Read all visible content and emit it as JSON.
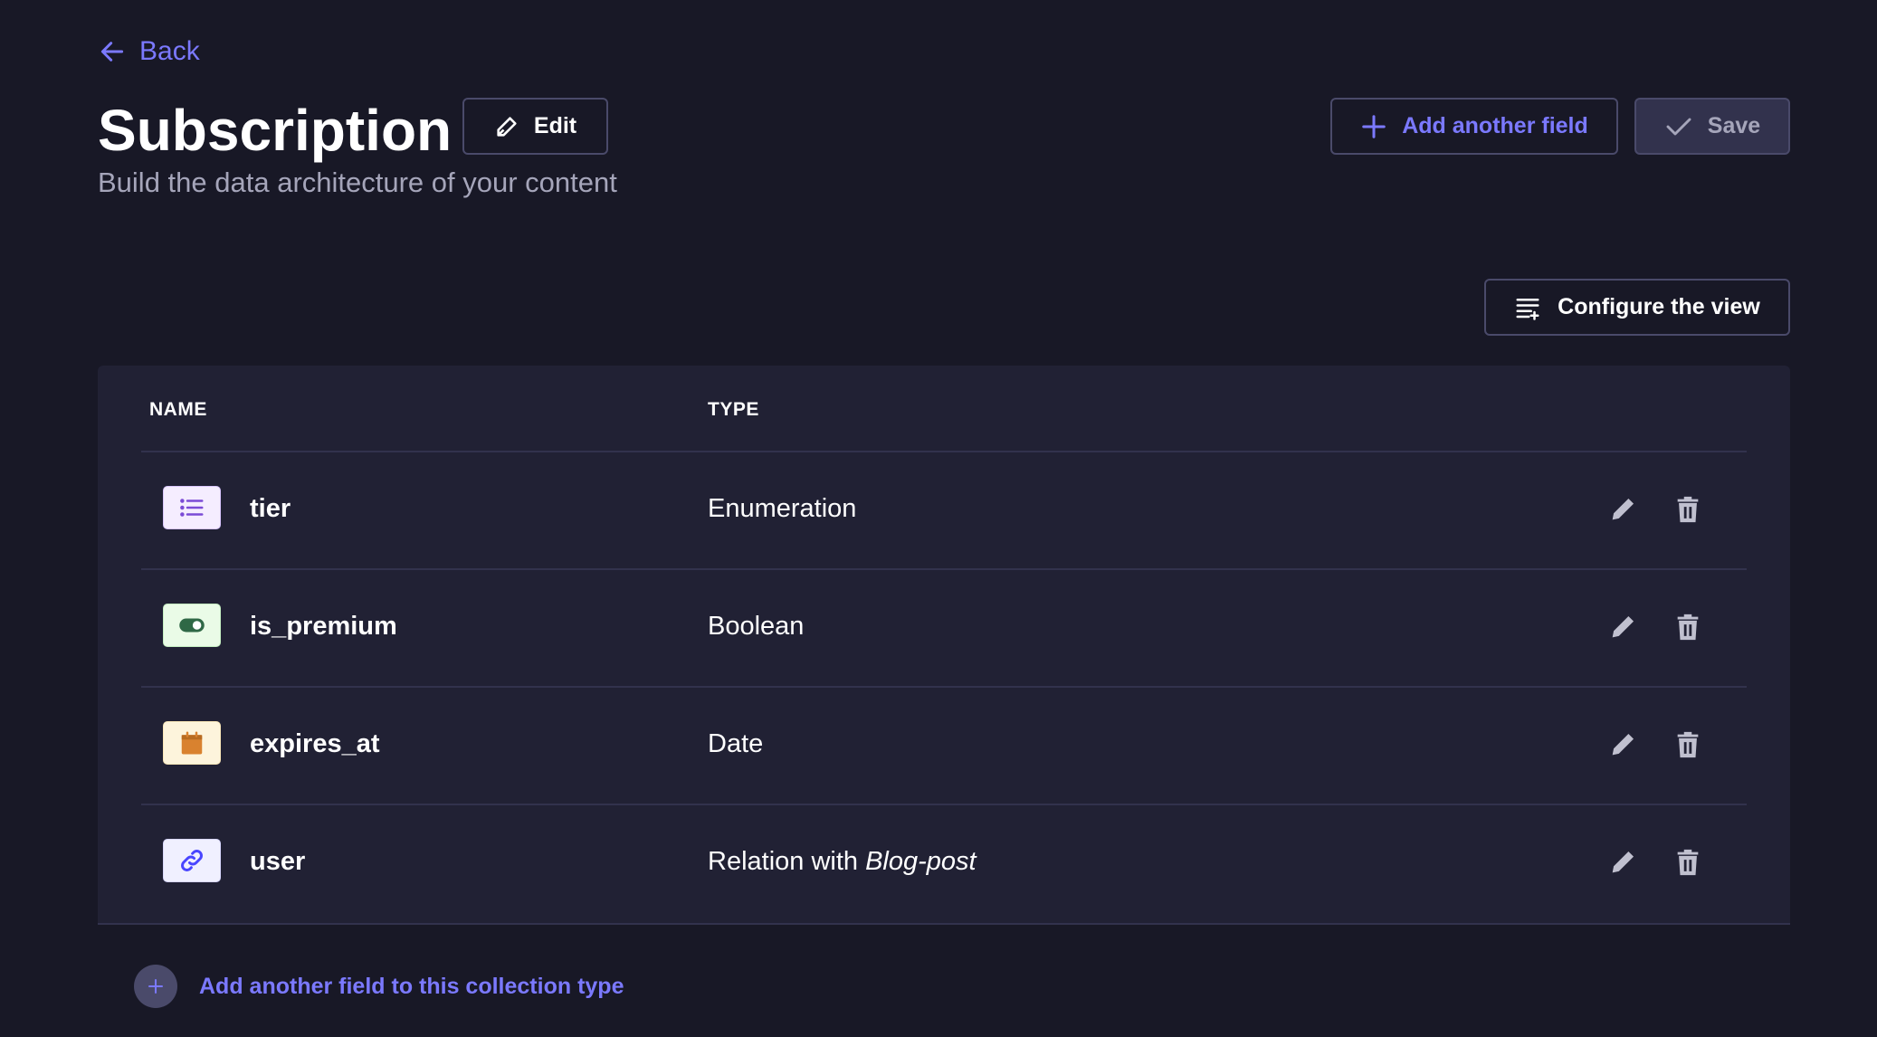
{
  "nav": {
    "back_label": "Back"
  },
  "header": {
    "title": "Subscription",
    "edit_label": "Edit",
    "subtitle": "Build the data architecture of your content",
    "add_field_label": "Add another field",
    "save_label": "Save"
  },
  "toolbar": {
    "configure_label": "Configure the view"
  },
  "table": {
    "columns": {
      "name": "NAME",
      "type": "TYPE"
    },
    "rows": [
      {
        "name": "tier",
        "type": "Enumeration",
        "type_target": "",
        "icon": "enumeration-icon",
        "icon_bg": "#f5edff",
        "icon_color": "#7b4bd6"
      },
      {
        "name": "is_premium",
        "type": "Boolean",
        "type_target": "",
        "icon": "boolean-icon",
        "icon_bg": "#eafbe7",
        "icon_color": "#2f6846"
      },
      {
        "name": "expires_at",
        "type": "Date",
        "type_target": "",
        "icon": "date-icon",
        "icon_bg": "#fdf4dc",
        "icon_color": "#d9822f"
      },
      {
        "name": "user",
        "type": "Relation with ",
        "type_target": "Blog-post",
        "icon": "relation-icon",
        "icon_bg": "#f0f0ff",
        "icon_color": "#4945ff"
      }
    ]
  },
  "footer": {
    "add_label": "Add another field to this collection type"
  },
  "colors": {
    "background": "#181826",
    "card": "#212134",
    "accent": "#7b79ff",
    "border": "#4a4a6a"
  }
}
